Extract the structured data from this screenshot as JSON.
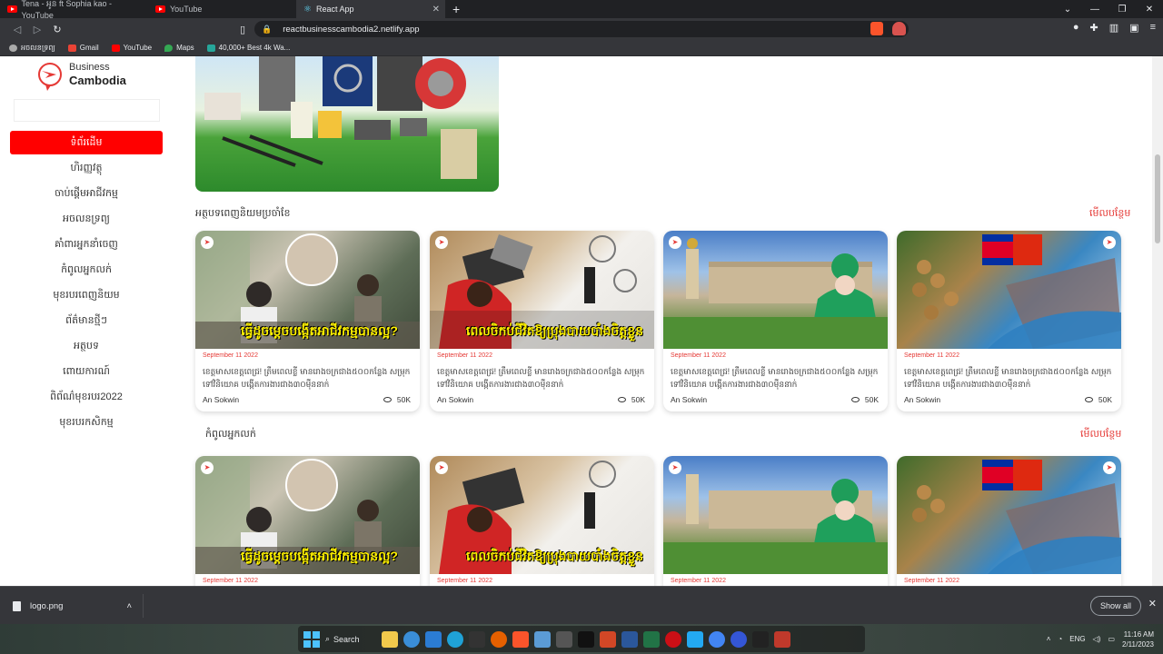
{
  "browser": {
    "tabs": [
      {
        "label": "Tena - អូន ft Sophia kao - YouTube",
        "icon": "youtube-icon"
      },
      {
        "label": "YouTube",
        "icon": "youtube-icon"
      },
      {
        "label": "React App",
        "icon": "react-icon",
        "active": true
      }
    ],
    "url": "reactbusinesscambodia2.netlify.app",
    "bookmarks": [
      "អចលនទ្រព្យ",
      "Gmail",
      "YouTube",
      "Maps",
      "40,000+ Best 4k Wa..."
    ]
  },
  "sidebar": {
    "brand_top": "Business",
    "brand_bottom": "Cambodia",
    "search_placeholder": "",
    "items": [
      {
        "label": "ទំព័រដើម",
        "active": true
      },
      {
        "label": "ហិរញ្ញវត្ថុ"
      },
      {
        "label": "ចាប់ផ្តើមអាជីវកម្ម"
      },
      {
        "label": "អចលនទ្រព្យ"
      },
      {
        "label": "គាំពារអ្នកនាំចេញ"
      },
      {
        "label": "កំពូលអ្នកលក់"
      },
      {
        "label": "មុខរបរពេញនិយម"
      },
      {
        "label": "ព័ត៌មានថ្មីៗ"
      },
      {
        "label": "អត្ថបទ"
      },
      {
        "label": "ពោយការណ៍"
      },
      {
        "label": "ពិព័ណ៌មុខរបរ2022"
      },
      {
        "label": "មុខរបរកសិកម្ម"
      }
    ]
  },
  "sections": [
    {
      "title": "អត្ថបទពេញនិយមប្រចាំខែ",
      "see_more": "មើលបន្ថែម"
    },
    {
      "title": "កំពូលអ្នកលក់",
      "see_more": "មើលបន្ថែម"
    }
  ],
  "cards": [
    {
      "date": "September 11 2022",
      "desc": "ខេត្តមាសខេត្តពេជ្រ! ត្រឹមពេលខ្លី មានរោងចក្រជាង៥០០កន្លែង សម្រុកទៅវិនិយោគ បង្កើតការងារជាង៣០ម៉ឺននាក់",
      "author": "An Sokwin",
      "views": "50K",
      "overlay": "ធ្វើដូចម្តេចបង្កើតអាជីវកម្មបានល្អ?"
    },
    {
      "date": "September 11 2022",
      "desc": "ខេត្តមាសខេត្តពេជ្រ! ត្រឹមពេលខ្លី មានរោងចក្រជាង៥០០កន្លែង សម្រុកទៅវិនិយោគ បង្កើតការងារជាង៣០ម៉ឺននាក់",
      "author": "An Sokwin",
      "views": "50K",
      "overlay": "ពេលចិកប់ជីវិតឱ្យប្រុងបាយបាំងចិត្តខ្លួន"
    },
    {
      "date": "September 11 2022",
      "desc": "ខេត្តមាសខេត្តពេជ្រ! ត្រឹមពេលខ្លី មានរោងចក្រជាង៥០០កន្លែង សម្រុកទៅវិនិយោគ បង្កើតការងារជាង៣០ម៉ឺននាក់",
      "author": "An Sokwin",
      "views": "50K",
      "overlay": ""
    },
    {
      "date": "September 11 2022",
      "desc": "ខេត្តមាសខេត្តពេជ្រ! ត្រឹមពេលខ្លី មានរោងចក្រជាង៥០០កន្លែង សម្រុកទៅវិនិយោគ បង្កើតការងារជាង៣០ម៉ឺននាក់",
      "author": "An Sokwin",
      "views": "50K",
      "overlay": ""
    }
  ],
  "downloads": {
    "file": "logo.png",
    "show_all": "Show all"
  },
  "taskbar": {
    "search": "Search",
    "lang": "ENG",
    "time": "11:16 AM",
    "date": "2/11/2023"
  },
  "colors": {
    "accent": "#ff0000",
    "link": "#e53935"
  }
}
